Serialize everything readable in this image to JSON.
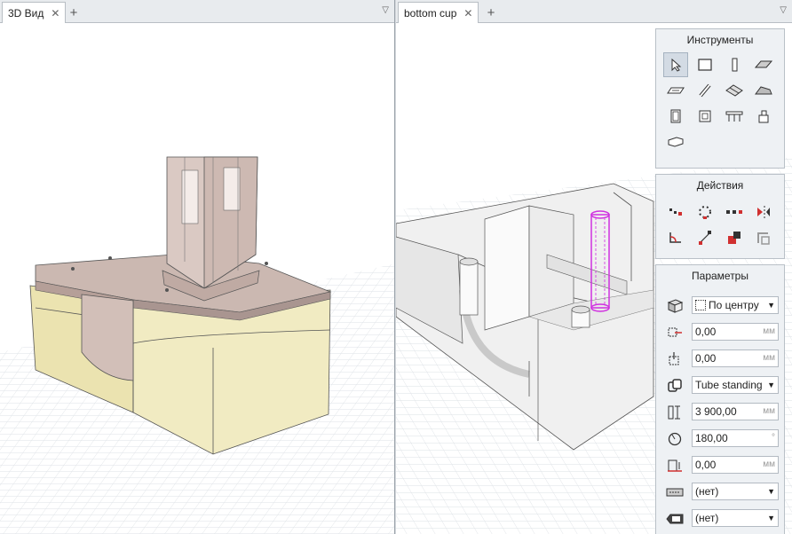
{
  "left_pane": {
    "tab_label": "3D Вид",
    "tab_close": "✕",
    "tab_add": "+",
    "tab_menu": "▽"
  },
  "right_pane": {
    "tab_label": "bottom cup",
    "tab_close": "✕",
    "tab_add": "+",
    "tab_menu": "▽"
  },
  "tools_panel": {
    "title": "Инструменты",
    "tools": [
      "select-arrow-icon",
      "slab-icon",
      "column-icon",
      "roof-icon",
      "stair-icon",
      "beam-icon",
      "mesh-icon",
      "shell-icon",
      "door-icon",
      "window-icon",
      "railing-icon",
      "object-icon",
      "zone-icon"
    ]
  },
  "actions_panel": {
    "title": "Действия"
  },
  "params_panel": {
    "title": "Параметры",
    "anchor_value": "По центру",
    "offset_x_value": "0,00",
    "offset_x_unit": "мм",
    "offset_y_value": "0,00",
    "offset_y_unit": "мм",
    "profile_value": "Tube standing",
    "height_value": "3 900,00",
    "height_unit": "мм",
    "angle_value": "180,00",
    "angle_unit": "°",
    "elevation_value": "0,00",
    "elevation_unit": "мм",
    "material_value": "(нет)",
    "label_value": "(нет)"
  },
  "colors": {
    "accent_selection": "#d030e0",
    "body_yellow": "#efe8b8",
    "lid_taupe": "#c8b4ad",
    "grid_line": "#dfe3e7"
  }
}
